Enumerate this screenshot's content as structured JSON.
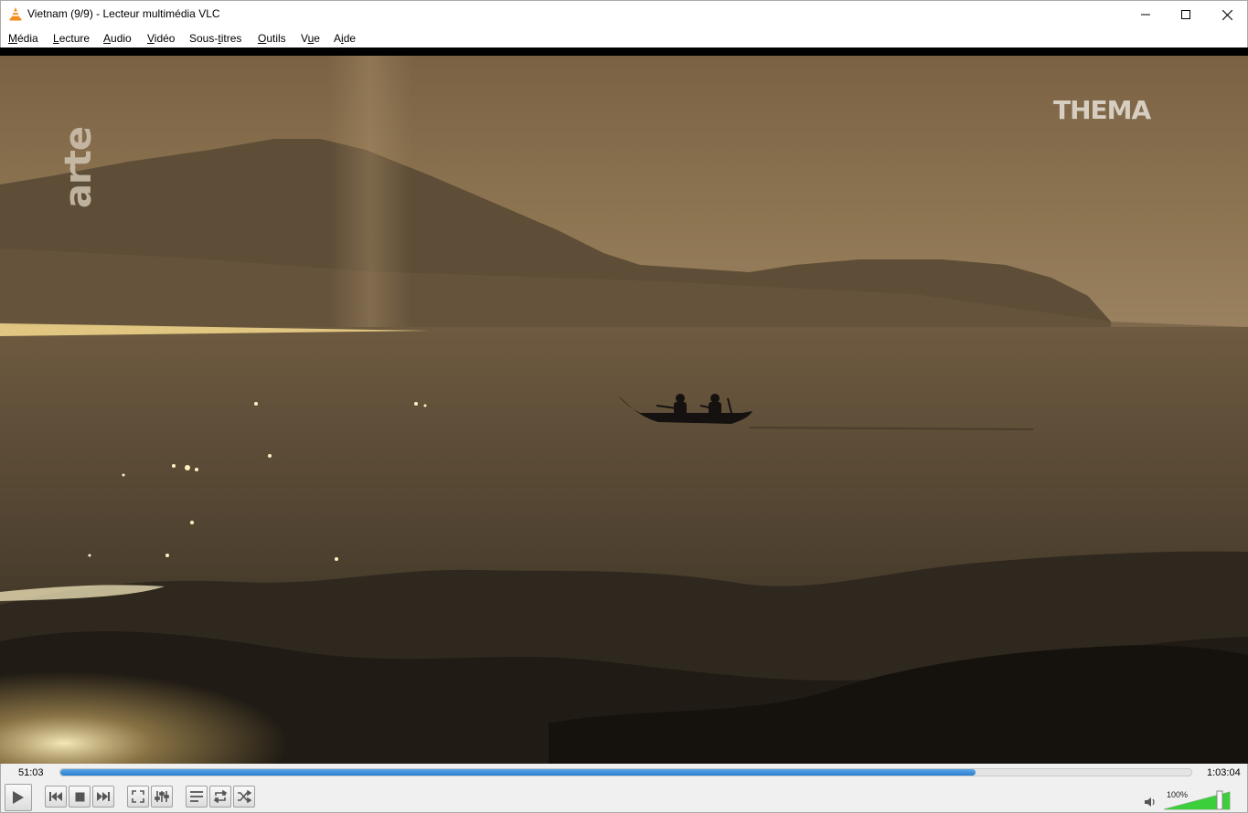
{
  "window": {
    "title": "Vietnam (9/9) - Lecteur multimédia VLC",
    "app_icon": "vlc-cone-icon",
    "buttons": [
      "minimize-icon",
      "maximize-icon",
      "close-icon"
    ]
  },
  "menu": {
    "items": [
      {
        "id": "media",
        "accel": "M",
        "rest": "édia"
      },
      {
        "id": "lecture",
        "accel": "L",
        "rest": "ecture"
      },
      {
        "id": "audio",
        "accel": "A",
        "rest": "udio"
      },
      {
        "id": "video",
        "accel": "V",
        "rest": "idéo"
      },
      {
        "id": "subtitles",
        "pre": "Sous-",
        "accel": "t",
        "rest": "itres"
      },
      {
        "id": "outils",
        "accel": "O",
        "rest": "utils"
      },
      {
        "id": "vue",
        "pre": "V",
        "accel": "u",
        "rest": "e"
      },
      {
        "id": "aide",
        "pre": "A",
        "accel": "i",
        "rest": "de"
      }
    ]
  },
  "video": {
    "watermark_left": "arte",
    "watermark_right": "THEMA"
  },
  "playback": {
    "elapsed": "51:03",
    "total": "1:03:04",
    "progress": 0.809
  },
  "controls": {
    "icons": [
      "play-icon",
      "previous-icon",
      "stop-icon",
      "next-icon",
      "fullscreen-icon",
      "extended-settings-icon",
      "playlist-icon",
      "loop-icon",
      "shuffle-icon"
    ],
    "volume_label": "100%",
    "volume": 1.0
  },
  "colors": {
    "accent": "#2a7ed0",
    "volume_green": "#3ccf3c"
  }
}
